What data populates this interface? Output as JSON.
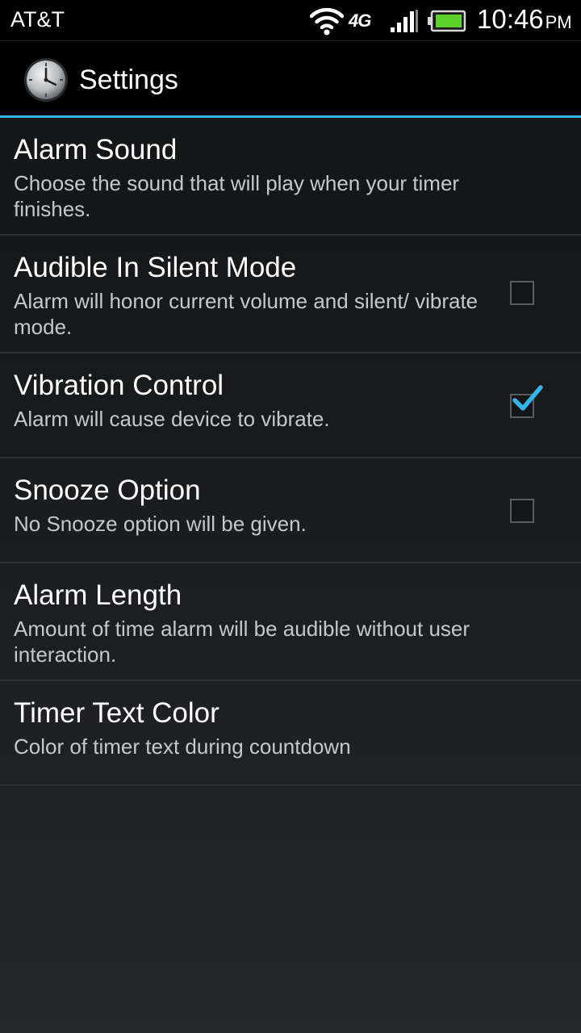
{
  "status_bar": {
    "carrier": "AT&T",
    "network_type": "4G",
    "time": "10:46",
    "ampm": "PM",
    "icons": [
      "wifi-icon",
      "signal-icon",
      "battery-icon"
    ]
  },
  "action_bar": {
    "title": "Settings",
    "icon": "clock-app-icon",
    "accent_color": "#33b5e5"
  },
  "preferences": [
    {
      "title": "Alarm Sound",
      "summary": "Choose the sound that will play when your timer finishes."
    },
    {
      "title": "Audible In Silent Mode",
      "summary": "Alarm will honor current volume and silent/ vibrate mode.",
      "checked": false
    },
    {
      "title": "Vibration Control",
      "summary": "Alarm will cause device to vibrate.",
      "checked": true
    },
    {
      "title": "Snooze Option",
      "summary": "No Snooze option will be given.",
      "checked": false
    },
    {
      "title": "Alarm Length",
      "summary": "Amount of time alarm will be audible without user interaction."
    },
    {
      "title": "Timer Text Color",
      "summary": "Color of timer text during countdown"
    }
  ],
  "colors": {
    "checkmark": "#33b5e5",
    "battery": "#5dd12b"
  }
}
